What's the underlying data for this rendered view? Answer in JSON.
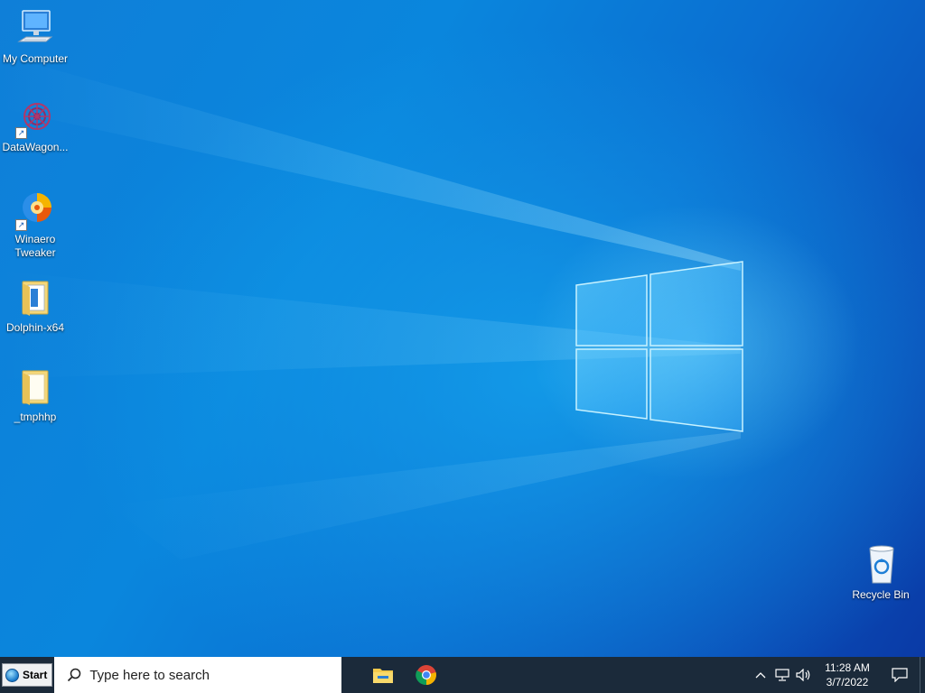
{
  "desktop": {
    "icons": [
      {
        "name": "my-computer",
        "label": "My Computer",
        "icon": "computer-icon"
      },
      {
        "name": "datawagon",
        "label": "DataWagon...",
        "icon": "datawagon-icon",
        "shortcut": true
      },
      {
        "name": "winaero-tweaker",
        "label": "Winaero Tweaker",
        "icon": "winaero-icon",
        "shortcut": true
      },
      {
        "name": "dolphin-x64",
        "label": "Dolphin-x64",
        "icon": "folder-icon"
      },
      {
        "name": "tmphhp",
        "label": "_tmphhp",
        "icon": "folder-icon"
      },
      {
        "name": "recycle-bin",
        "label": "Recycle Bin",
        "icon": "recycle-bin-icon"
      }
    ]
  },
  "taskbar": {
    "start_label": "Start",
    "search_placeholder": "Type here to search",
    "pinned": [
      {
        "name": "file-explorer",
        "icon": "folder-icon"
      },
      {
        "name": "chrome",
        "icon": "chrome-icon"
      }
    ],
    "tray": {
      "time": "11:28 AM",
      "date": "3/7/2022"
    }
  },
  "colors": {
    "taskbar_bg": "#1b2a3a",
    "desktop_accent": "#0a86dd"
  }
}
